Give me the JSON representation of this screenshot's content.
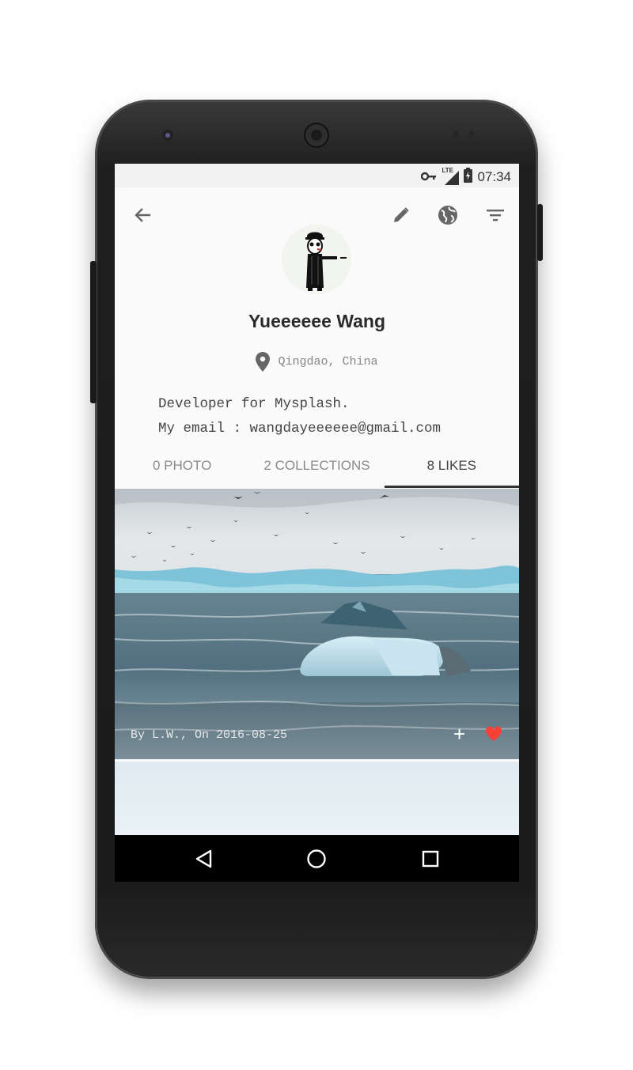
{
  "status_bar": {
    "time": "07:34",
    "network": "LTE"
  },
  "toolbar": {
    "back_icon": "arrow-back-icon",
    "edit_icon": "pencil-icon",
    "web_icon": "globe-icon",
    "filter_icon": "filter-icon"
  },
  "profile": {
    "name": "Yueeeeee Wang",
    "location": "Qingdao, China",
    "bio_line1": "Developer for Mysplash.",
    "bio_line2": "My email : wangdayeeeeee@gmail.com"
  },
  "tabs": [
    {
      "label": "0 PHOTO",
      "active": false
    },
    {
      "label": "2 COLLECTIONS",
      "active": false
    },
    {
      "label": "8 LIKES",
      "active": true
    }
  ],
  "photo": {
    "caption": "By L.W., On 2016-08-25",
    "add_icon": "plus-icon",
    "like_icon": "heart-icon",
    "like_color": "#f44336"
  },
  "nav": {
    "back": "nav-back-icon",
    "home": "nav-home-icon",
    "recents": "nav-recents-icon"
  }
}
